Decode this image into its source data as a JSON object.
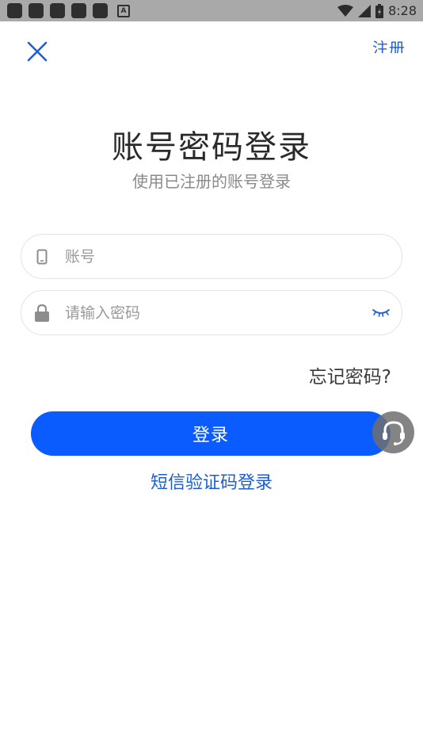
{
  "status_bar": {
    "time": "8:28",
    "notification_icons": [
      "app-icon",
      "app-icon",
      "app-icon",
      "app-icon",
      "app-icon",
      "a-icon"
    ],
    "status_icons": [
      "wifi-icon",
      "signal-icon",
      "battery-icon"
    ],
    "background": "#a9a9a9"
  },
  "header": {
    "close_icon": "close-icon",
    "register_label": "注册"
  },
  "login": {
    "title": "账号密码登录",
    "subtitle": "使用已注册的账号登录",
    "account_placeholder": "账号",
    "account_icon": "phone-icon",
    "password_placeholder": "请输入密码",
    "password_icon": "lock-icon",
    "password_toggle_icon": "eye-closed-icon",
    "forgot_label": "忘记密码?",
    "submit_label": "登录",
    "sms_login_label": "短信验证码登录",
    "support_icon": "headset-icon"
  },
  "colors": {
    "accent": "#0a5cff",
    "link": "#1b5fd1",
    "icon_blue": "#1f5ed6",
    "placeholder": "#9a9a9a"
  }
}
